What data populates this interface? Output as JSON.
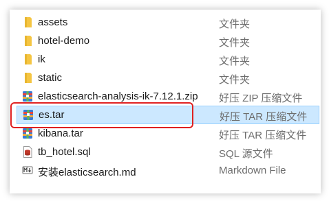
{
  "files": [
    {
      "name": "assets",
      "type": "文件夹",
      "icon": "folder-icon"
    },
    {
      "name": "hotel-demo",
      "type": "文件夹",
      "icon": "folder-icon"
    },
    {
      "name": "ik",
      "type": "文件夹",
      "icon": "folder-icon"
    },
    {
      "name": "static",
      "type": "文件夹",
      "icon": "folder-icon"
    },
    {
      "name": "elasticsearch-analysis-ik-7.12.1.zip",
      "type": "好压 ZIP 压缩文件",
      "icon": "archive-icon"
    },
    {
      "name": "es.tar",
      "type": "好压 TAR 压缩文件",
      "icon": "archive-icon",
      "selected": true
    },
    {
      "name": "kibana.tar",
      "type": "好压 TAR 压缩文件",
      "icon": "archive-icon"
    },
    {
      "name": "tb_hotel.sql",
      "type": "SQL 源文件",
      "icon": "sql-file-icon"
    },
    {
      "name": "安装elasticsearch.md",
      "type": "Markdown File",
      "icon": "markdown-file-icon"
    }
  ],
  "colors": {
    "selection_bg": "#cce8ff",
    "selection_border": "#99d1ff",
    "highlight": "#e02020",
    "folder": "#f5c542"
  }
}
